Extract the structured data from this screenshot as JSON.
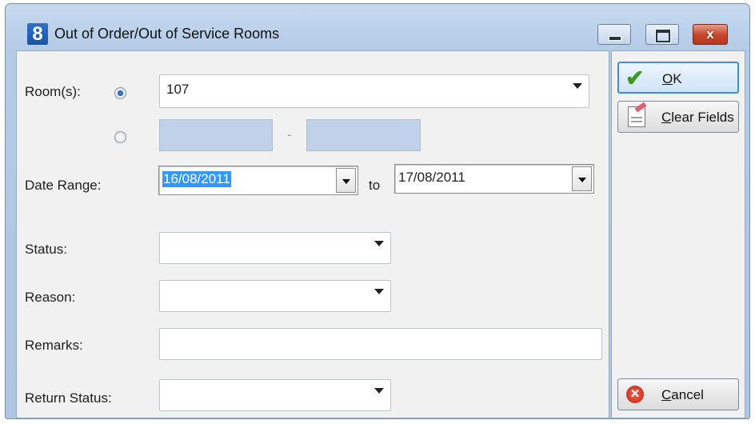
{
  "window": {
    "app_icon_text": "8",
    "title": "Out of Order/Out of Service Rooms",
    "minimize_icon": "minimize-icon",
    "maximize_icon": "maximize-icon",
    "close_glyph": "x"
  },
  "form": {
    "rooms_label": "Room(s):",
    "room_value": "107",
    "range_separator": "-",
    "date_range_label": "Date Range:",
    "date_from": "16/08/2011",
    "to_label": "to",
    "date_to": "17/08/2011",
    "status_label": "Status:",
    "status_value": "",
    "reason_label": "Reason:",
    "reason_value": "",
    "remarks_label": "Remarks:",
    "remarks_value": "",
    "return_status_label": "Return Status:",
    "return_status_value": ""
  },
  "buttons": {
    "ok_label": "OK",
    "clear_label": "Clear Fields",
    "cancel_label": "Cancel",
    "ok_icon": "checkmark-icon",
    "clear_icon": "eraser-icon",
    "cancel_icon": "cancel-icon"
  },
  "colors": {
    "selection": "#3399ff",
    "disabled_field": "#bfd2ea",
    "window_frame": "#b4cbe6"
  }
}
